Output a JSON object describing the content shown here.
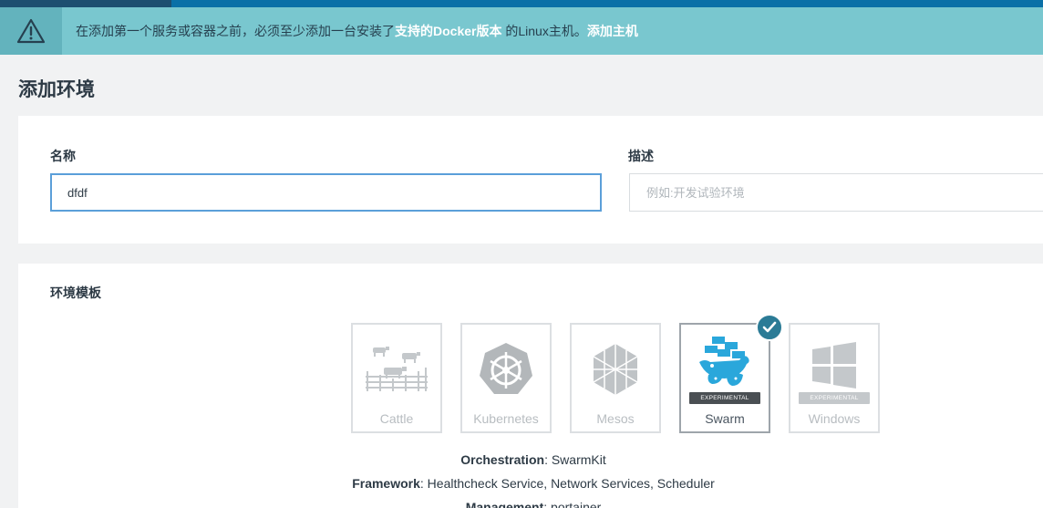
{
  "banner": {
    "message_prefix": "在添加第一个服务或容器之前，必须至少添加一台安装了",
    "docker_link": "支持的Docker版本",
    "message_mid": " 的Linux主机。",
    "add_host_link": "添加主机",
    "icon": "warning-icon"
  },
  "page": {
    "title": "添加环境"
  },
  "form": {
    "name_label": "名称",
    "name_value": "dfdf",
    "desc_label": "描述",
    "desc_placeholder": "例如:开发试验环境"
  },
  "templates": {
    "label": "环境模板",
    "items": [
      {
        "name": "Cattle",
        "icon": "cattle-icon",
        "selected": false,
        "experimental": false
      },
      {
        "name": "Kubernetes",
        "icon": "kubernetes-icon",
        "selected": false,
        "experimental": false
      },
      {
        "name": "Mesos",
        "icon": "mesos-icon",
        "selected": false,
        "experimental": false
      },
      {
        "name": "Swarm",
        "icon": "swarm-docker-icon",
        "selected": true,
        "experimental": true
      },
      {
        "name": "Windows",
        "icon": "windows-icon",
        "selected": false,
        "experimental": true
      }
    ],
    "experimental_label": "EXPERIMENTAL"
  },
  "details": {
    "orchestration_label": "Orchestration",
    "orchestration_value": ": SwarmKit",
    "framework_label": "Framework",
    "framework_value": ": Healthcheck Service, Network Services, Scheduler",
    "management_label": "Management",
    "management_value": ": portainer"
  },
  "colors": {
    "banner_bg": "#79c7cf",
    "accent": "#2b7b96",
    "focus_border": "#5b9fd9"
  }
}
